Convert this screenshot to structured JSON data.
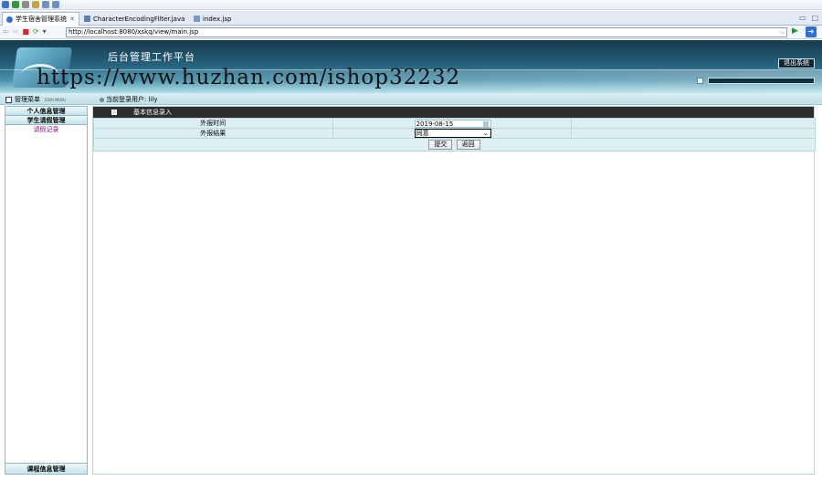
{
  "ide": {
    "tabs": [
      {
        "label": "学生宿舍管理系统",
        "active": true
      },
      {
        "label": "CharacterEncodingFilter.java",
        "active": false
      },
      {
        "label": "index.jsp",
        "active": false
      }
    ],
    "url": "http://localhost:8080/xskq/view/main.jsp"
  },
  "header": {
    "platform_title": "后台管理工作平台",
    "exit_label": "退出系统",
    "watermark": "https://www.huzhan.com/ishop32232"
  },
  "subbar": {
    "menu_title": "管理菜单",
    "menu_title_en": "ESIM MENU",
    "current_user": "当前登录用户: lily"
  },
  "sidebar": {
    "items": [
      {
        "label": "个人信息管理"
      },
      {
        "label": "学生请假管理"
      }
    ],
    "sub_items": [
      {
        "label": "请假记录"
      }
    ],
    "footer": "课程信息管理"
  },
  "form": {
    "heading": "基本信息录入",
    "rows": [
      {
        "label": "外报时间",
        "value": "2019-08-15"
      },
      {
        "label": "外报结果",
        "value": "同意"
      }
    ],
    "submit_label": "提交",
    "back_label": "返回"
  },
  "colors": {
    "header_dark": "#173a4d",
    "header_light": "#a8dbe6",
    "table_bg": "#deeff3",
    "sidebar_sub_text": "#8a1a80"
  }
}
